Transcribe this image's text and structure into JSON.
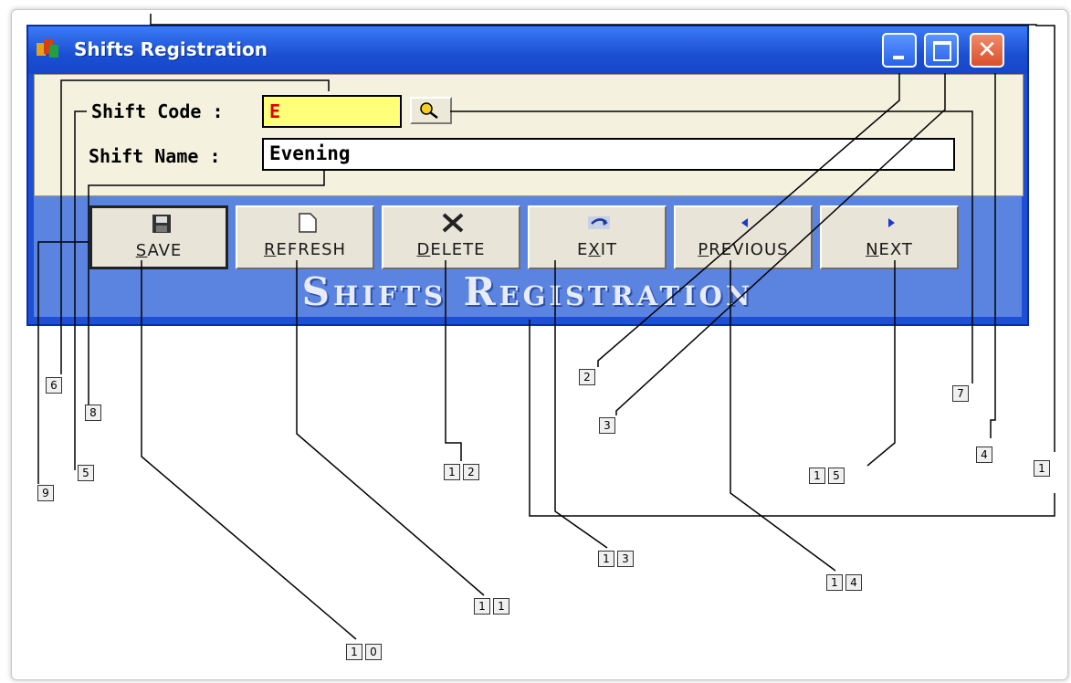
{
  "window": {
    "title": "Shifts Registration",
    "close_glyph": "✕"
  },
  "form": {
    "shift_code_label": "Shift Code :",
    "shift_code_value": "E",
    "shift_name_label": "Shift Name :",
    "shift_name_value": "Evening"
  },
  "toolbar": {
    "buttons": [
      {
        "first": "S",
        "rest": "AVE",
        "icon": "floppy-disk-icon"
      },
      {
        "first": "R",
        "rest": "EFRESH",
        "icon": "blank-page-icon"
      },
      {
        "first": "D",
        "rest": "ELETE",
        "icon": "delete-x-icon"
      },
      {
        "pre": "E",
        "first": "X",
        "rest": "IT",
        "icon": "exit-arrow-icon"
      },
      {
        "first": "P",
        "rest": "REVIOUS",
        "icon": "triangle-left-icon"
      },
      {
        "first": "N",
        "rest": "EXT",
        "icon": "triangle-right-icon"
      }
    ],
    "banner": "Shifts Registration"
  },
  "callouts": {
    "c1": [
      "1"
    ],
    "c2": [
      "2"
    ],
    "c3": [
      "3"
    ],
    "c4": [
      "4"
    ],
    "c5": [
      "5"
    ],
    "c6": [
      "6"
    ],
    "c7": [
      "7"
    ],
    "c8": [
      "8"
    ],
    "c9": [
      "9"
    ],
    "c10": [
      "1",
      "0"
    ],
    "c11": [
      "1",
      "1"
    ],
    "c12": [
      "1",
      "2"
    ],
    "c13": [
      "1",
      "3"
    ],
    "c14": [
      "1",
      "4"
    ],
    "c15": [
      "1",
      "5"
    ]
  },
  "colors": {
    "title_bar": "#1a4fd3",
    "form_bg": "#f4f1de",
    "toolbar_bg": "#5b84e0",
    "code_field_bg": "#ffff7a",
    "code_text": "#e00000"
  }
}
